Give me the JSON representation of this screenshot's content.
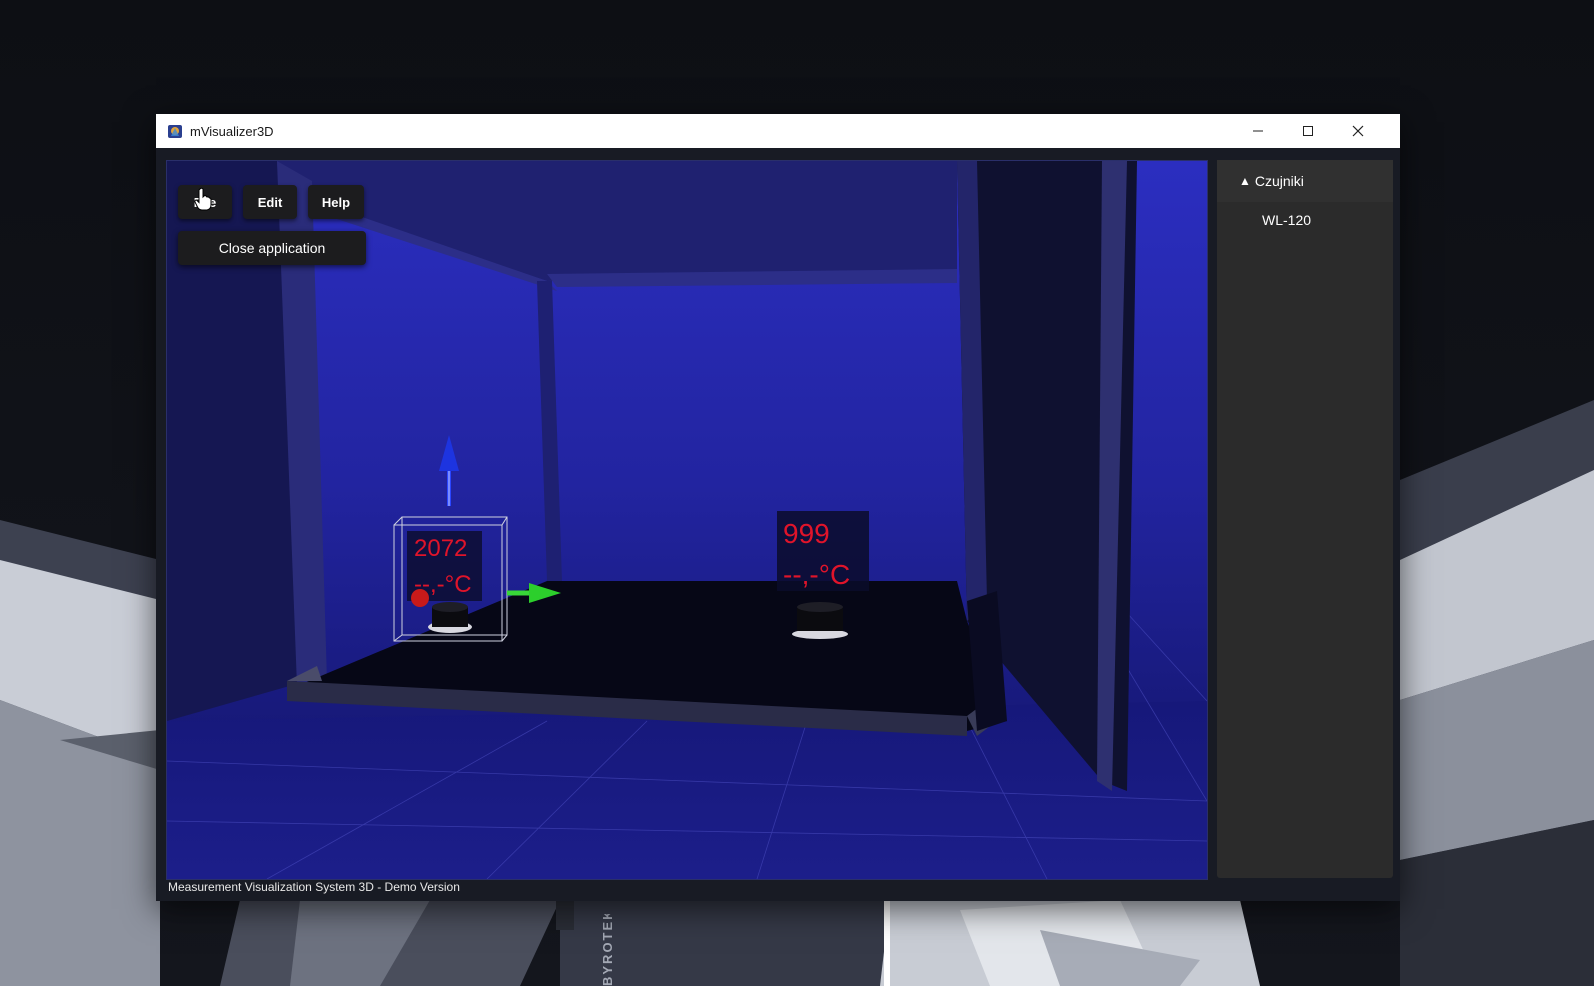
{
  "window": {
    "title": "mVisualizer3D"
  },
  "menu": {
    "file_label": "File",
    "edit_label": "Edit",
    "help_label": "Help",
    "dropdown_item": "Close application"
  },
  "sidebar": {
    "header": "Czujniki",
    "items": [
      {
        "label": "WL-120"
      }
    ]
  },
  "scene": {
    "sensor_1": {
      "value": "2072",
      "temperature": "--,-°C"
    },
    "sensor_2": {
      "value": "999",
      "temperature": "--,-°C"
    }
  },
  "statusbar": {
    "text": "Measurement Visualization System 3D - Demo Version"
  },
  "desktop": {
    "wallpaper_text": "BYROTEK"
  },
  "colors": {
    "scene_background": "#2a2bb0",
    "sensor_text": "#e0142a",
    "panel": "#2b2b2b",
    "menu_button": "#1c1c1e"
  },
  "icons": {
    "app": "app-icon",
    "minimize": "minimize-icon",
    "maximize": "maximize-icon",
    "close": "close-icon",
    "collapse": "triangle-up-icon",
    "cursor": "hand-cursor-icon"
  }
}
